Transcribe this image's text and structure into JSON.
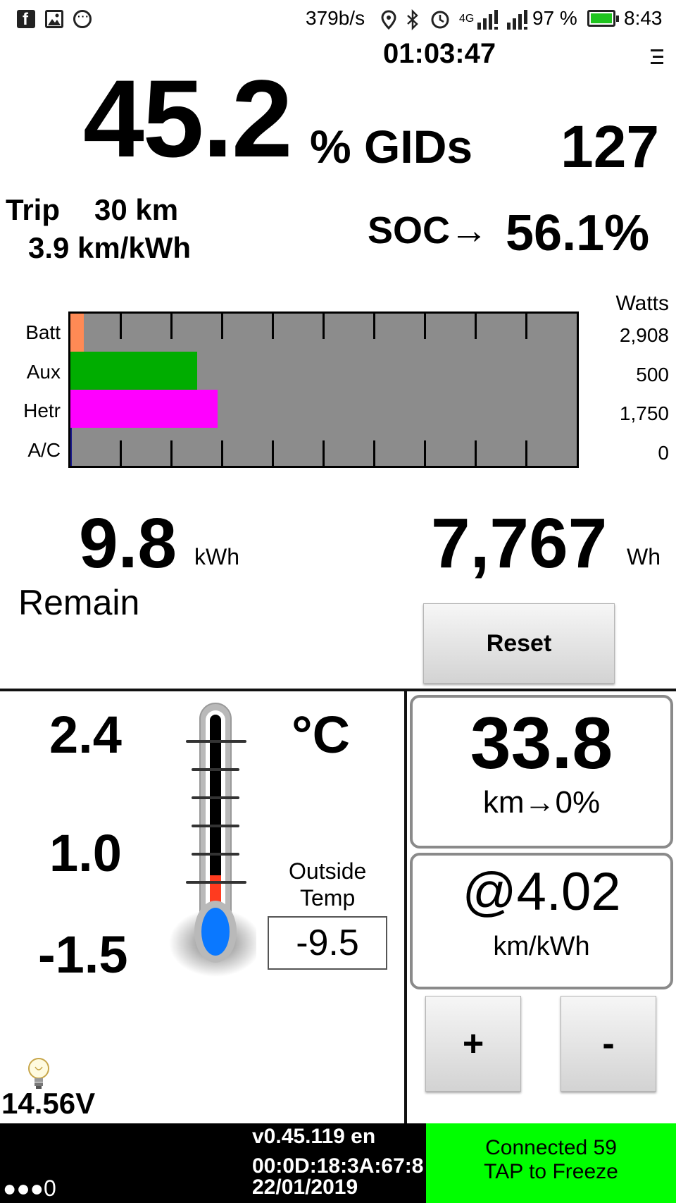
{
  "status_bar": {
    "left_icons": [
      "facebook-icon",
      "gallery-icon",
      "messenger-icon"
    ],
    "net_speed": "379b/s",
    "network_type": "4G",
    "battery_percent": "97 %",
    "time": "8:43"
  },
  "top": {
    "elapsed": "01:03:47",
    "gids_percent": "45.2",
    "gids_unit": "% GIDs",
    "gids_count": "127",
    "trip_label": "Trip",
    "trip_distance": "30 km",
    "trip_efficiency": "3.9 km/kWh",
    "soc_label": "SOC→",
    "soc_value": "56.1%"
  },
  "chart_data": {
    "type": "bar",
    "orientation": "horizontal",
    "categories": [
      "Batt",
      "Aux",
      "Hetr",
      "A/C"
    ],
    "values": [
      2908,
      500,
      1750,
      0
    ],
    "value_labels": [
      "2,908",
      "500",
      "1,750",
      "0"
    ],
    "unit_label": "Watts",
    "bar_fill_fractions": [
      0.027,
      0.25,
      0.29,
      0.003
    ],
    "colors": [
      "#ff8a55",
      "#00ad00",
      "#ff00ff",
      "#1a1a8c"
    ],
    "background": "#8c8c8c",
    "gridlines": 10
  },
  "energy": {
    "remain_value": "9.8",
    "remain_unit": "kWh",
    "remain_label": "Remain",
    "used_value": "7,767",
    "used_unit": "Wh",
    "reset_label": "Reset"
  },
  "temperature": {
    "high": "2.4",
    "mid": "1.0",
    "low": "-1.5",
    "unit": "°C",
    "outside_label_1": "Outside",
    "outside_label_2": "Temp",
    "outside_value": "-9.5",
    "thermometer_level": 0.1
  },
  "battery_voltage": "14.56V",
  "range": {
    "distance": "33.8",
    "distance_label": "km→0%",
    "efficiency": "@4.02",
    "efficiency_unit": "km/kWh",
    "plus_label": "+",
    "minus_label": "-"
  },
  "footer": {
    "dots": "●●●0",
    "version": "v0.45.119 en",
    "mac": "00:0D:18:3A:67:8",
    "date": "22/01/2019",
    "connection": "Connected 59",
    "tap_hint": "TAP to Freeze",
    "connected_color": "#00ff00"
  }
}
